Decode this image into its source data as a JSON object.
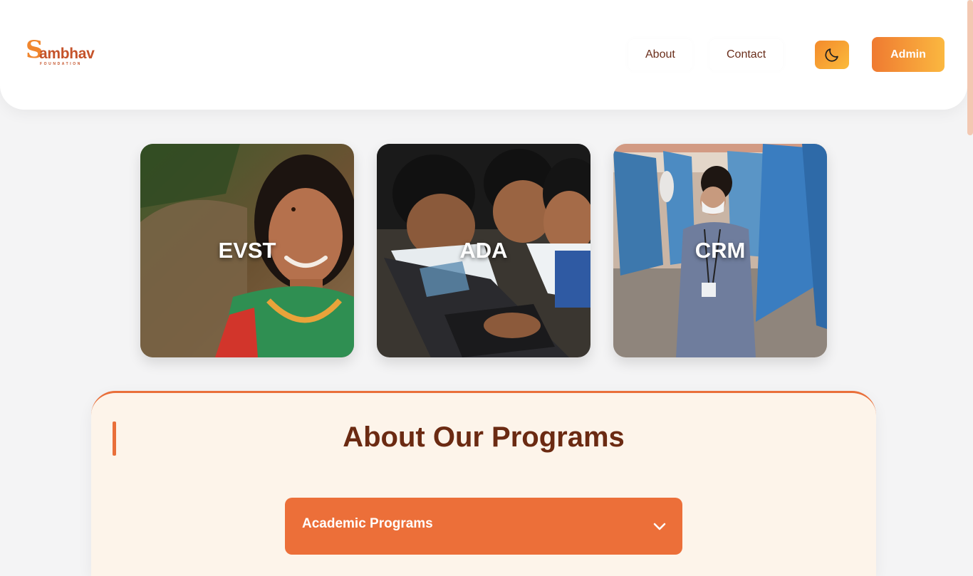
{
  "logo": {
    "mark": "S",
    "word": "ambhav",
    "sub": "FOUNDATION"
  },
  "nav": {
    "about": "About",
    "contact": "Contact",
    "admin": "Admin"
  },
  "theme_toggle": {
    "icon": "moon-icon"
  },
  "cards": [
    {
      "label": "EVST"
    },
    {
      "label": "ADA"
    },
    {
      "label": "CRM"
    }
  ],
  "about_section": {
    "title": "About Our Programs",
    "accordion": {
      "title": "Academic Programs",
      "icon": "chevron-down-icon"
    }
  },
  "colors": {
    "accent": "#ec6f39",
    "brand_dark": "#6b2a12",
    "admin_gradient_start": "#ef7a31",
    "admin_gradient_end": "#fbb840",
    "page_bg": "#f4f4f5",
    "section_bg": "#fdf4ea"
  }
}
